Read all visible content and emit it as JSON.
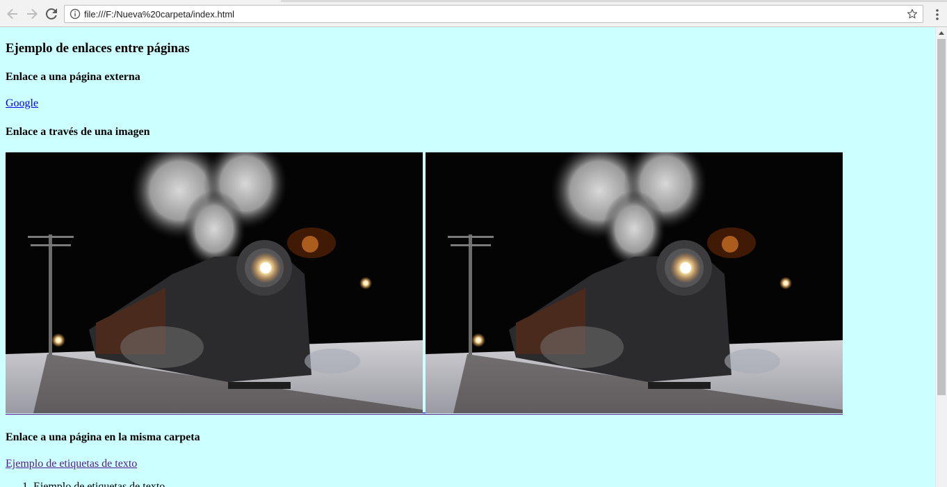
{
  "browser": {
    "url": "file:///F:/Nueva%20carpeta/index.html",
    "icons": {
      "back": "arrow-left-icon",
      "forward": "arrow-right-icon",
      "reload": "reload-icon",
      "site_info": "info-icon",
      "bookmark": "star-icon",
      "menu": "vertical-dots-icon"
    }
  },
  "page": {
    "background_color": "#ccffff",
    "title": "Ejemplo de enlaces entre páginas",
    "section_external": "Enlace a una página externa",
    "external_link": "Google",
    "section_image": "Enlace a través de una imagen",
    "images": [
      {
        "description": "steam-locomotive-night"
      },
      {
        "description": "steam-locomotive-night"
      }
    ],
    "section_same_folder": "Enlace a una página en la misma carpeta",
    "same_folder_link": "Ejemplo de etiquetas de texto",
    "list": [
      {
        "number": "1.",
        "text": "Ejemplo de etiquetas de texto"
      }
    ]
  },
  "colors": {
    "link": "#0000ee",
    "visited_link": "#551a8b"
  }
}
